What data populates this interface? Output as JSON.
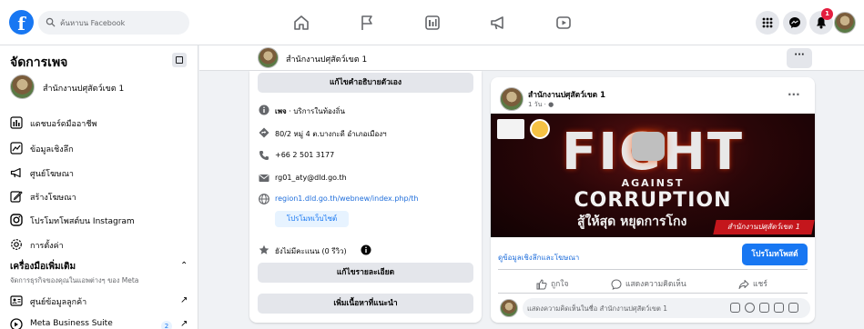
{
  "topbar": {
    "logo": "f",
    "search_placeholder": "ค้นหาบน Facebook",
    "notification_count": "1",
    "icons": [
      "home-icon",
      "flag-icon",
      "pages-insights-icon",
      "megaphone-icon",
      "video-icon",
      "grid-menu-icon",
      "messenger-icon",
      "bell-icon"
    ]
  },
  "sidebar": {
    "title": "จัดการเพจ",
    "page_name": "สำนักงานปศุสัตว์เขต 1",
    "items": [
      {
        "label": "แดชบอร์ดมืออาชีพ",
        "icon": "dashboard-icon"
      },
      {
        "label": "ข้อมูลเชิงลึก",
        "icon": "insights-icon"
      },
      {
        "label": "ศูนย์โฆษณา",
        "icon": "ad-center-icon"
      },
      {
        "label": "สร้างโฆษณา",
        "icon": "create-ad-icon"
      },
      {
        "label": "โปรโมทโพสต์บน Instagram",
        "icon": "instagram-icon"
      },
      {
        "label": "การตั้งค่า",
        "icon": "settings-icon"
      }
    ],
    "tools_section": {
      "title": "เครื่องมือเพิ่มเติม",
      "subtitle": "จัดการธุรกิจของคุณในแอพต่างๆ ของ Meta",
      "items": [
        {
          "label": "ศูนย์ข้อมูลลูกค้า"
        },
        {
          "label": "Meta Business Suite",
          "badge": "2"
        }
      ]
    }
  },
  "page_header": {
    "name": "สำนักงานปศุสัตว์เขต 1",
    "more": "···"
  },
  "intro": {
    "edit_bio_button": "แก้ไขคำอธิบายตัวเอง",
    "category_prefix": "เพจ",
    "category": " · บริการในท้องถิ่น",
    "address": "80/2 หมู่ 4 ต.บางกะดี อำเภอเมืองฯ",
    "phone": "+66 2 501 3177",
    "email": "rg01_aty@dld.go.th",
    "website": "region1.dld.go.th/webnew/index.php/th",
    "promote_website_button": "โปรโมทเว็บไซต์",
    "rating": "ยังไม่มีคะแนน (0 รีวิว)",
    "edit_details_button": "แก้ไขรายละเอียด",
    "add_featured_button": "เพิ่มเนื้อหาที่แนะนำ"
  },
  "post": {
    "author": "สำนักงานปศุสัตว์เขต 1",
    "time": "1 วัน · ",
    "more": "···",
    "banner": {
      "headline": "FIGHT",
      "line2": "AGAINST",
      "line3": "CORRUPTION",
      "thai_line": "สู้ให้สุด หยุดการโกง",
      "tag": "สำนักงานปศุสัตว์เขต 1"
    },
    "insights_link": "ดูข้อมูลเชิงลึกและโฆษณา",
    "boost_button": "โปรโมทโพสต์",
    "actions": {
      "like": "ถูกใจ",
      "comment": "แสดงความคิดเห็น",
      "share": "แชร์"
    },
    "comment_placeholder": "แสดงความคิดเห็นในชื่อ สำนักงานปศุสัตว์เขต 1"
  },
  "colors": {
    "brand_blue": "#1877f2",
    "link_blue": "#216fdb",
    "notification_red": "#e41e3f",
    "background": "#f0f2f5"
  }
}
